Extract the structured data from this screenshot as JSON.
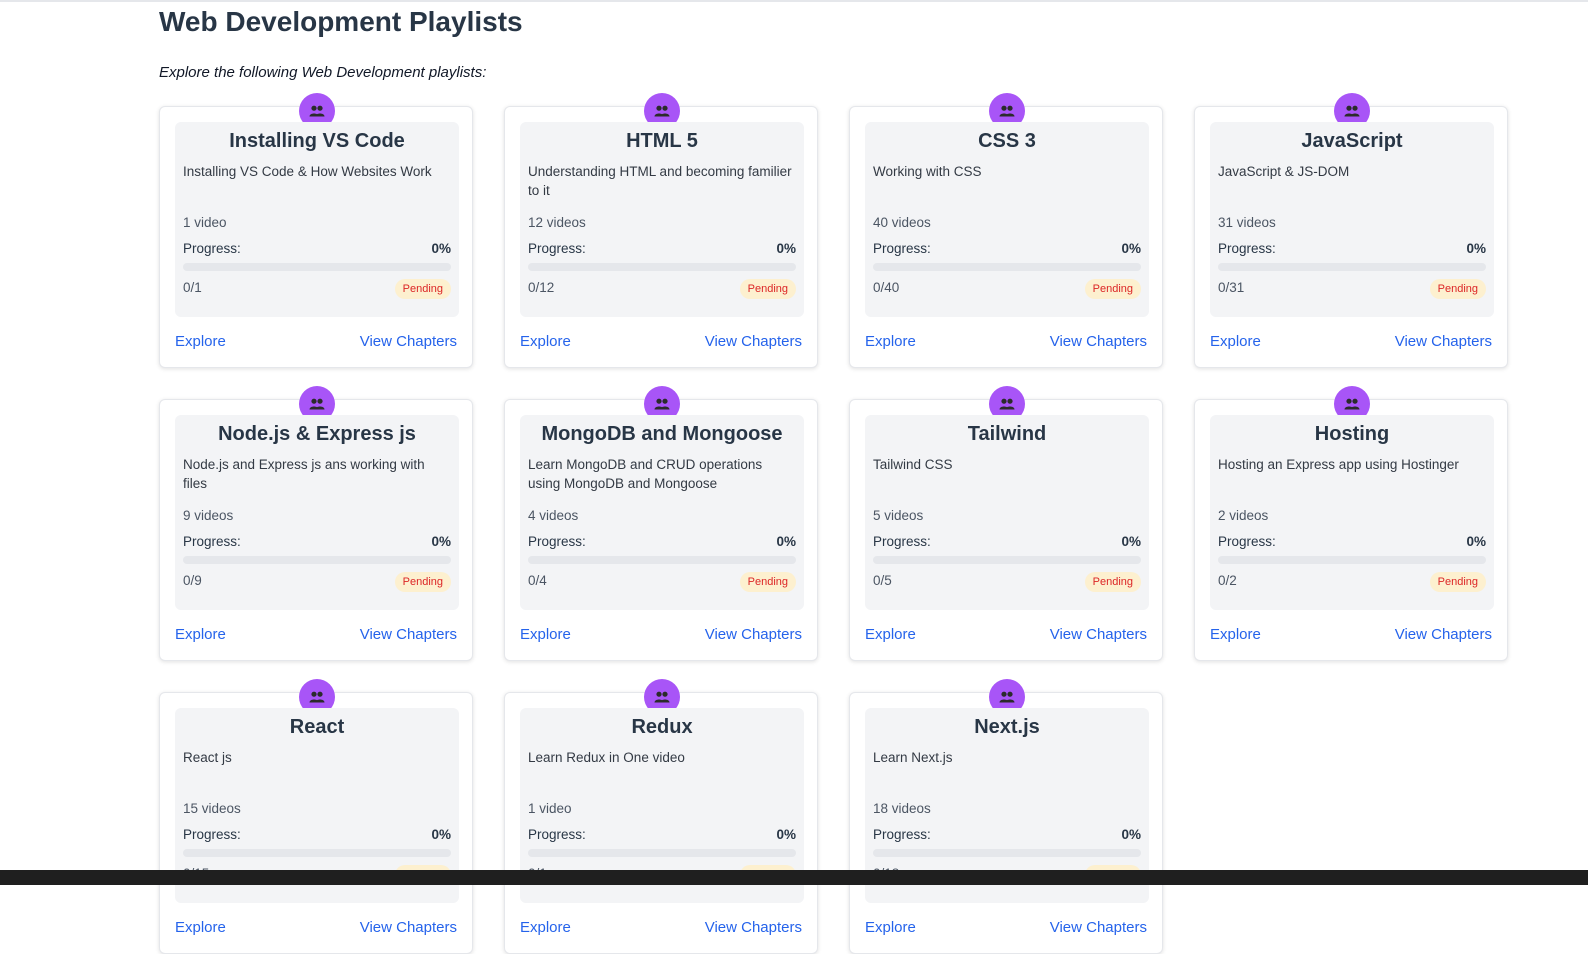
{
  "page": {
    "title": "Web Development Playlists",
    "subtitle": "Explore the following Web Development playlists:"
  },
  "colors": {
    "accent_purple": "#a855f7",
    "link_blue": "#2563eb",
    "badge_bg": "#fdf0cf",
    "badge_text": "#dc2626",
    "card_inner_bg": "#f3f4f6"
  },
  "labels": {
    "progress": "Progress:",
    "explore": "Explore",
    "view_chapters": "View Chapters"
  },
  "icons": {
    "card_avatar": "users-icon"
  },
  "playlists": [
    {
      "title": "Installing VS Code",
      "description": "Installing VS Code & How Websites Work",
      "videos": "1 video",
      "progress_text": "0%",
      "progress_fraction": 0,
      "count": "0/1",
      "status": "Pending"
    },
    {
      "title": "HTML 5",
      "description": "Understanding HTML and becoming familier to it",
      "videos": "12 videos",
      "progress_text": "0%",
      "progress_fraction": 0,
      "count": "0/12",
      "status": "Pending"
    },
    {
      "title": "CSS 3",
      "description": "Working with CSS",
      "videos": "40 videos",
      "progress_text": "0%",
      "progress_fraction": 0,
      "count": "0/40",
      "status": "Pending"
    },
    {
      "title": "JavaScript",
      "description": "JavaScript & JS-DOM",
      "videos": "31 videos",
      "progress_text": "0%",
      "progress_fraction": 0,
      "count": "0/31",
      "status": "Pending"
    },
    {
      "title": "Node.js & Express js",
      "description": "Node.js and Express js ans working with files",
      "videos": "9 videos",
      "progress_text": "0%",
      "progress_fraction": 0,
      "count": "0/9",
      "status": "Pending"
    },
    {
      "title": "MongoDB and Mongoose",
      "description": "Learn MongoDB and CRUD operations using MongoDB and Mongoose",
      "videos": "4 videos",
      "progress_text": "0%",
      "progress_fraction": 0,
      "count": "0/4",
      "status": "Pending"
    },
    {
      "title": "Tailwind",
      "description": "Tailwind CSS",
      "videos": "5 videos",
      "progress_text": "0%",
      "progress_fraction": 0,
      "count": "0/5",
      "status": "Pending"
    },
    {
      "title": "Hosting",
      "description": "Hosting an Express app using Hostinger",
      "videos": "2 videos",
      "progress_text": "0%",
      "progress_fraction": 0,
      "count": "0/2",
      "status": "Pending"
    },
    {
      "title": "React",
      "description": "React js",
      "videos": "15 videos",
      "progress_text": "0%",
      "progress_fraction": 0,
      "count": "0/15",
      "status": "Pending"
    },
    {
      "title": "Redux",
      "description": "Learn Redux in One video",
      "videos": "1 video",
      "progress_text": "0%",
      "progress_fraction": 0,
      "count": "0/1",
      "status": "Pending"
    },
    {
      "title": "Next.js",
      "description": "Learn Next.js",
      "videos": "18 videos",
      "progress_text": "0%",
      "progress_fraction": 0,
      "count": "0/18",
      "status": "Pending"
    }
  ]
}
